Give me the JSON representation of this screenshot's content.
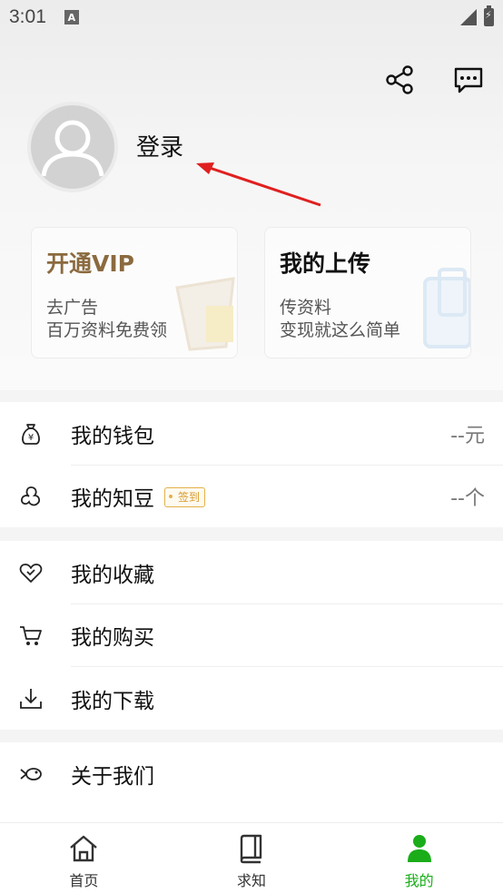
{
  "status_bar": {
    "time": "3:01"
  },
  "header": {
    "login_label": "登录"
  },
  "cards": [
    {
      "title": "开通VIP",
      "line1": "去广告",
      "line2": "百万资料免费领"
    },
    {
      "title": "我的上传",
      "line1": "传资料",
      "line2": "变现就这么简单"
    }
  ],
  "menu": {
    "wallet": {
      "label": "我的钱包",
      "value": "--元"
    },
    "zhidou": {
      "label": "我的知豆",
      "badge": "签到",
      "value": "--个"
    },
    "favorites": {
      "label": "我的收藏"
    },
    "purchases": {
      "label": "我的购买"
    },
    "downloads": {
      "label": "我的下载"
    },
    "about": {
      "label": "关于我们"
    }
  },
  "bottom_nav": [
    {
      "label": "首页",
      "icon": "home-icon",
      "active": false
    },
    {
      "label": "求知",
      "icon": "book-icon",
      "active": false
    },
    {
      "label": "我的",
      "icon": "profile-icon",
      "active": true
    }
  ],
  "colors": {
    "accent": "#1aad19",
    "vip_gold": "#8b6a3f",
    "arrow_red": "#e02020",
    "badge": "#e3b14a"
  }
}
